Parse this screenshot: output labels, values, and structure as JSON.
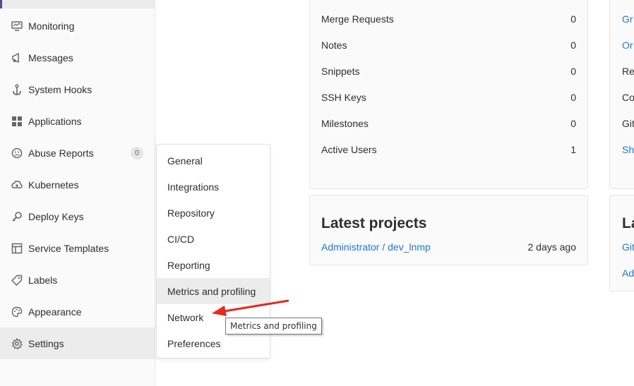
{
  "sidebar": {
    "items": [
      {
        "label": "Monitoring",
        "icon": "monitor-icon"
      },
      {
        "label": "Messages",
        "icon": "megaphone-icon"
      },
      {
        "label": "System Hooks",
        "icon": "anchor-icon"
      },
      {
        "label": "Applications",
        "icon": "grid-icon"
      },
      {
        "label": "Abuse Reports",
        "icon": "sad-face-icon",
        "badge": "0"
      },
      {
        "label": "Kubernetes",
        "icon": "cloud-gear-icon"
      },
      {
        "label": "Deploy Keys",
        "icon": "key-icon"
      },
      {
        "label": "Service Templates",
        "icon": "template-icon"
      },
      {
        "label": "Labels",
        "icon": "tag-icon"
      },
      {
        "label": "Appearance",
        "icon": "palette-icon"
      },
      {
        "label": "Settings",
        "icon": "gear-icon",
        "active": true
      }
    ]
  },
  "stats": {
    "rows": [
      {
        "label": "Merge Requests",
        "value": "0"
      },
      {
        "label": "Notes",
        "value": "0"
      },
      {
        "label": "Snippets",
        "value": "0"
      },
      {
        "label": "SSH Keys",
        "value": "0"
      },
      {
        "label": "Milestones",
        "value": "0"
      },
      {
        "label": "Active Users",
        "value": "1"
      }
    ]
  },
  "latest_projects": {
    "title": "Latest projects",
    "project_link": "Administrator / dev_lnmp",
    "project_time": "2 days ago"
  },
  "right_card": {
    "top_items": [
      "Gr",
      "Or",
      "Re",
      "Co",
      "Git",
      "Sh"
    ],
    "bottom_title": "La",
    "bottom_items": [
      "Git",
      "Ad"
    ]
  },
  "dropdown": {
    "items": [
      "General",
      "Integrations",
      "Repository",
      "CI/CD",
      "Reporting",
      "Metrics and profiling",
      "Network",
      "Preferences"
    ]
  },
  "tooltip": {
    "text": "Metrics and profiling"
  },
  "colors": {
    "accent": "#4b4ba3",
    "link": "#1f78d1",
    "arrow": "#e8281e"
  }
}
